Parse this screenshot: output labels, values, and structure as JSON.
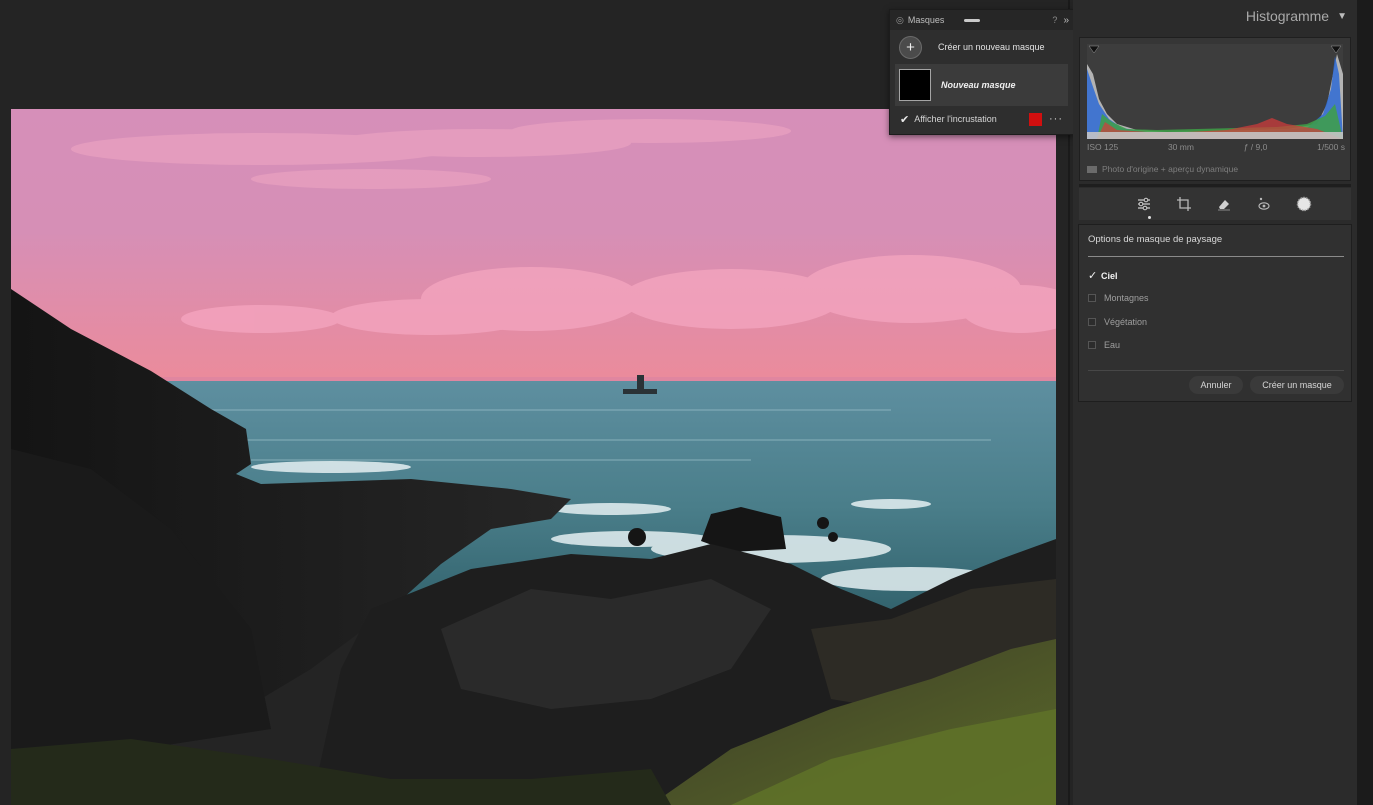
{
  "masks_panel": {
    "title": "Masques",
    "help": "?",
    "collapse": "»",
    "create_label": "Créer un nouveau masque",
    "mask_name": "Nouveau masque",
    "overlay_label": "Afficher l'incrustation",
    "overlay_checked": true,
    "overlay_color": "#d10f0f",
    "more": "···"
  },
  "histogram": {
    "title": "Histogramme",
    "collapse_icon": "triangle-down-icon",
    "exif": [
      "ISO 125",
      "30 mm",
      "ƒ / 9,0",
      "1/500 s"
    ],
    "preview_label": "Photo d'origine + aperçu dynamique"
  },
  "tools": [
    {
      "icon": "sliders-icon",
      "active": true
    },
    {
      "icon": "crop-icon",
      "active": false
    },
    {
      "icon": "eraser-icon",
      "active": false
    },
    {
      "icon": "redeye-icon",
      "active": false
    },
    {
      "icon": "masking-icon",
      "active": false
    }
  ],
  "landscape_options": {
    "title": "Options de masque de paysage",
    "items": [
      {
        "label": "Ciel",
        "checked": true
      },
      {
        "label": "Montagnes",
        "checked": false
      },
      {
        "label": "Végétation",
        "checked": false
      },
      {
        "label": "Eau",
        "checked": false
      }
    ],
    "cancel_label": "Annuler",
    "create_label": "Créer un masque"
  }
}
